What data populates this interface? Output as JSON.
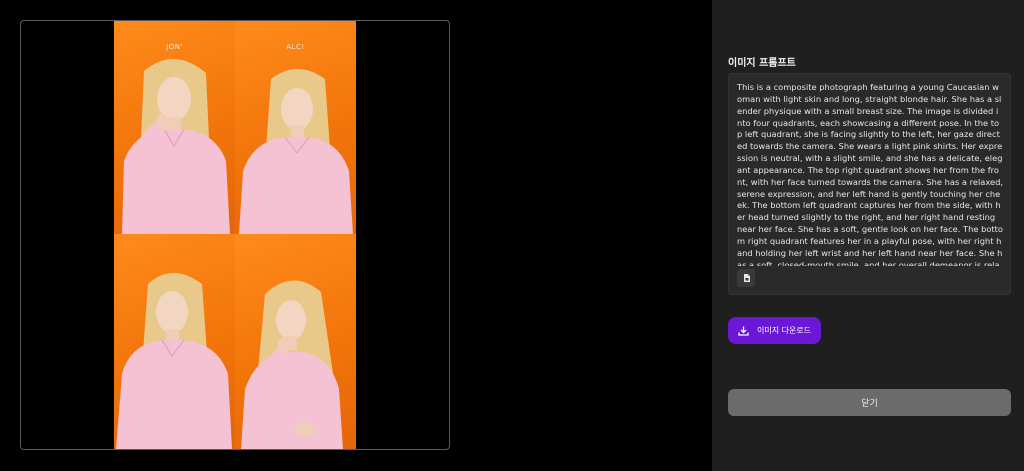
{
  "image": {
    "cells": [
      {
        "label": "JON'"
      },
      {
        "label": "ALC!"
      },
      {
        "label": ""
      },
      {
        "label": ""
      }
    ]
  },
  "panel": {
    "title": "이미지 프롬프트",
    "prompt": "This is a composite photograph featuring a young Caucasian woman with light skin and long, straight blonde hair. She has a slender physique with a small breast size. The image is divided into four quadrants, each showcasing a different pose. In the top left quadrant, she is facing slightly to the left, her gaze directed towards the camera. She wears a light pink shirts. Her expression is neutral, with a slight smile, and she has a delicate, elegant appearance. The top right quadrant shows her from the front, with her face turned towards the camera. She has a relaxed, serene expression, and her left hand is gently touching her cheek. The bottom left quadrant captures her from the side, with her head turned slightly to the right, and her right hand resting near her face. She has a soft, gentle look on her face. The bottom right quadrant features her in a playful pose, with her right hand holding her left wrist and her left hand near her face. She has a soft, closed-mouth smile, and her overall demeanor is relaxed and serene. The background is a solid, deep",
    "copy_icon": "copy-icon",
    "download_label": "이미지 다운로드",
    "download_icon": "download-icon",
    "close_label": "닫기"
  },
  "colors": {
    "accent": "#6a18d6",
    "background_orange": "#f2750a",
    "shirt_pink": "#f4c2d2",
    "panel_bg": "#1f1f1f"
  }
}
